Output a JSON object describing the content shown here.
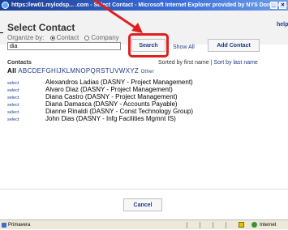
{
  "window": {
    "title": "https://ew01.mylodsp... .com - Select Contact - Microsoft Internet Explorer provided by NYS Dormitor..."
  },
  "header": {
    "title": "Select Contact",
    "help_label": "help"
  },
  "organize": {
    "label": "Organize by:",
    "options": [
      "Contact",
      "Company"
    ],
    "selected": "Contact"
  },
  "search": {
    "value": "dia",
    "button_label": "Search",
    "show_all_label": "Show All",
    "add_contact_label": "Add Contact"
  },
  "contacts": {
    "label": "Contacts",
    "sorted_text": "Sorted by first name |",
    "sort_last_label": "Sort by last name",
    "alphabet_all": "All",
    "alphabet": [
      "A",
      "B",
      "C",
      "D",
      "E",
      "F",
      "G",
      "H",
      "I",
      "J",
      "K",
      "L",
      "M",
      "N",
      "O",
      "P",
      "Q",
      "R",
      "S",
      "T",
      "U",
      "V",
      "W",
      "X",
      "Y",
      "Z"
    ],
    "alphabet_other": "Other",
    "select_label": "select",
    "rows": [
      "Alexandros Ladias (DASNY - Project Management)",
      "Alvaro Diaz (DASNY - Project Management)",
      "Diana Castro (DASNY - Project Management)",
      "Diana Damasca (DASNY - Accounts Payable)",
      "Dianne Rinaldi (DASNY - Const Technology Group)",
      "John Dias (DASNY - Infg Facilities Mgmnt IS)"
    ]
  },
  "footer": {
    "cancel_label": "Cancel"
  },
  "statusbar": {
    "left_label": "Primavera",
    "zone_label": "Internet"
  },
  "colors": {
    "highlight": "#e0201e",
    "link": "#1f3c88",
    "titlebar": "#1c3f94"
  }
}
